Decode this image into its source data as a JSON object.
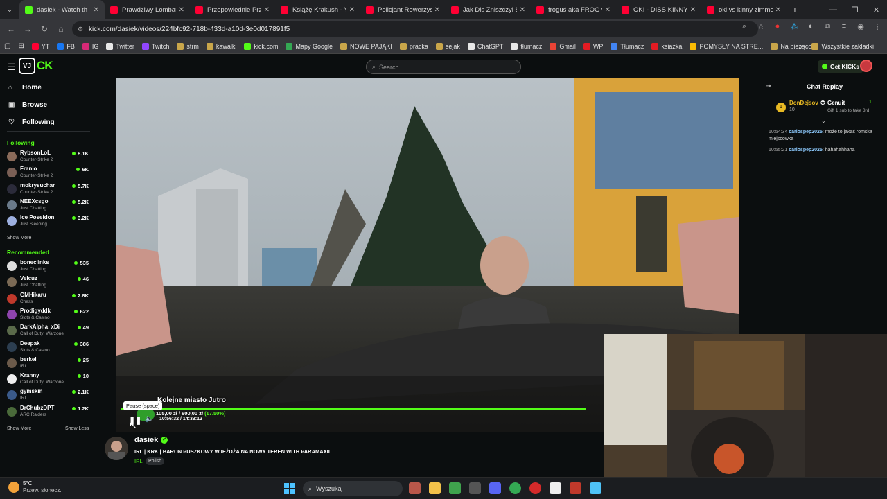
{
  "browser": {
    "tabs": [
      {
        "title": "dasiek - Watch th",
        "color": "#53fc18",
        "active": true
      },
      {
        "title": "Prawdziwy Lombard",
        "color": "#ff0033"
      },
      {
        "title": "Przepowiednie Przes",
        "color": "#ff0033"
      },
      {
        "title": "Książę Krakush - You",
        "color": "#ff0033"
      },
      {
        "title": "Policjant Rowerzysta",
        "color": "#ff0033"
      },
      {
        "title": "Jak Dis Zniszczył Swo",
        "color": "#ff0033"
      },
      {
        "title": "froguś aka FROG wb",
        "color": "#ff0033"
      },
      {
        "title": "OKI - DISS KINNY ZIM",
        "color": "#ff0033"
      },
      {
        "title": "oki vs kinny zimmer",
        "color": "#ff0033"
      }
    ],
    "url": "kick.com/dasiek/videos/224bfc92-718b-433d-a10d-3e0d017891f5",
    "bookmarks": [
      {
        "label": "YT",
        "color": "#ff0033"
      },
      {
        "label": "FB",
        "color": "#1877f2"
      },
      {
        "label": "IG",
        "color": "#d62976"
      },
      {
        "label": "Twitter",
        "color": "#e7e7e7"
      },
      {
        "label": "Twitch",
        "color": "#9146ff"
      },
      {
        "label": "strm",
        "color": "#c9a64a"
      },
      {
        "label": "kawałki",
        "color": "#c9a64a"
      },
      {
        "label": "kick.com",
        "color": "#53fc18"
      },
      {
        "label": "Mapy Google",
        "color": "#34a853"
      },
      {
        "label": "NOWE PAJĄKI",
        "color": "#c9a64a"
      },
      {
        "label": "pracka",
        "color": "#c9a64a"
      },
      {
        "label": "sejak",
        "color": "#c9a64a"
      },
      {
        "label": "ChatGPT",
        "color": "#e7e7e7"
      },
      {
        "label": "tłumacz",
        "color": "#e7e7e7"
      },
      {
        "label": "Gmail",
        "color": "#ea4335"
      },
      {
        "label": "WP",
        "color": "#e31b23"
      },
      {
        "label": "Tłumacz",
        "color": "#4285f4"
      },
      {
        "label": "ksiazka",
        "color": "#e31b23"
      },
      {
        "label": "POMYSŁY NA STRE...",
        "color": "#fbbc04"
      },
      {
        "label": "Na bieżąco",
        "color": "#c9a64a"
      }
    ],
    "bookmarks_all": "Wszystkie zakładki"
  },
  "kick": {
    "search_placeholder": "Search",
    "get_kicks": "Get KICKs",
    "nav": {
      "home": "Home",
      "browse": "Browse",
      "following": "Following"
    },
    "following_title": "Following",
    "following": [
      {
        "name": "RybsonLoL",
        "category": "Counter-Strike 2",
        "viewers": "8.1K",
        "color": "#8a6b5a"
      },
      {
        "name": "Franio",
        "category": "Counter-Strike 2",
        "viewers": "6K",
        "color": "#7a5f55"
      },
      {
        "name": "mokrysuchar",
        "category": "Counter-Strike 2",
        "viewers": "5.7K",
        "color": "#2b2b3a"
      },
      {
        "name": "NEEXcsgo",
        "category": "Just Chatting",
        "viewers": "5.2K",
        "color": "#6a7a8a"
      },
      {
        "name": "Ice Poseidon",
        "category": "Just Sleeping",
        "viewers": "3.2K",
        "color": "#9db0e0"
      }
    ],
    "recommended_title": "Recommended",
    "recommended": [
      {
        "name": "boneclinks",
        "category": "Just Chatting",
        "viewers": "535",
        "color": "#ddd"
      },
      {
        "name": "Velcuz",
        "category": "Just Chatting",
        "viewers": "46",
        "color": "#7b6a55"
      },
      {
        "name": "GMHikaru",
        "category": "Chess",
        "viewers": "2.8K",
        "color": "#c0392b"
      },
      {
        "name": "Prodigyddk",
        "category": "Slots & Casino",
        "viewers": "622",
        "color": "#8e44ad"
      },
      {
        "name": "DarkAlpha_xDi",
        "category": "Call of Duty: Warzone",
        "viewers": "49",
        "color": "#5a6a4a"
      },
      {
        "name": "Deepak",
        "category": "Slots & Casino",
        "viewers": "386",
        "color": "#2c3e50"
      },
      {
        "name": "berkel",
        "category": "IRL",
        "viewers": "25",
        "color": "#6b5a4a"
      },
      {
        "name": "Kranny",
        "category": "Call of Duty: Warzone",
        "viewers": "10",
        "color": "#eeeeee"
      },
      {
        "name": "gymskin",
        "category": "IRL",
        "viewers": "2.1K",
        "color": "#3a5a8a"
      },
      {
        "name": "DrChubzDPT",
        "category": "ARC Raiders",
        "viewers": "1.2K",
        "color": "#4a6a3a"
      }
    ],
    "show_more": "Show More",
    "show_less": "Show Less"
  },
  "player": {
    "overlay_title": "Kolejne miasto Jutro",
    "goal_text": "105,00 zł / 600,00 zł",
    "goal_pct": "(17.50%)",
    "time": "10:56:32 / 14:33:12",
    "tooltip": "Pause (space)",
    "progress": 0.753
  },
  "stream": {
    "streamer": "dasiek",
    "title": "IRL | KRK | BARON PUSZKOWY WJEŻDŻA NA NOWY TEREN WITH PARAMAXIL",
    "category": "IRL",
    "language": "Polish"
  },
  "chat": {
    "title": "Chat Replay",
    "pinned_user": "DonDejsov",
    "pinned_count": "10",
    "pinned_gifter": "Genuit",
    "pinned_gift_count": "1",
    "pinned_text": "Gift 1 sub to take 3rd",
    "messages": [
      {
        "time": "10:54:34",
        "user": "carlospep2025",
        "text": "może to jakaś romska miejscowka"
      },
      {
        "time": "10:55:21",
        "user": "carlospep2025",
        "text": "hahahahhaha"
      }
    ]
  },
  "taskbar": {
    "temp": "5°C",
    "weather": "Przew. słonecz.",
    "search": "Wyszukaj"
  }
}
